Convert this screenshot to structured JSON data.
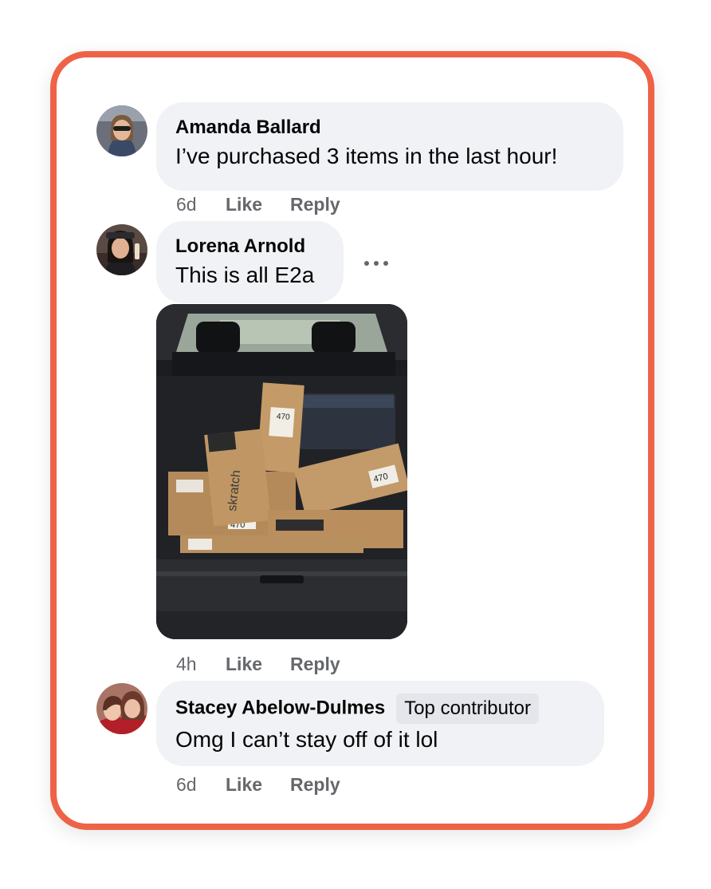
{
  "comments": [
    {
      "author": "Amanda Ballard",
      "text": "I’ve purchased 3 items in the last hour!",
      "time": "6d",
      "like_label": "Like",
      "reply_label": "Reply"
    },
    {
      "author": "Lorena Arnold",
      "text": "This is all E2a",
      "time": "4h",
      "like_label": "Like",
      "reply_label": "Reply",
      "more_icon": "more-horizontal-icon",
      "photo": {
        "box_label_1": "470",
        "box_label_2": "470",
        "box_label_3": "470",
        "box_brand": "skratch"
      }
    },
    {
      "author": "Stacey Abelow-Dulmes",
      "badge": "Top contributor",
      "text": "Omg I can’t stay off of it lol",
      "time": "6d",
      "like_label": "Like",
      "reply_label": "Reply"
    }
  ],
  "colors": {
    "frame_border": "#ee6347",
    "bubble_bg": "#f0f2f5",
    "meta_text": "#65676b"
  }
}
